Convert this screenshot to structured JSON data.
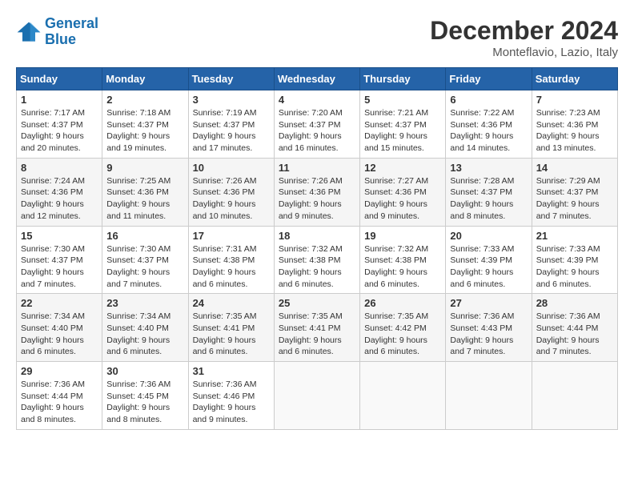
{
  "logo": {
    "line1": "General",
    "line2": "Blue"
  },
  "title": "December 2024",
  "location": "Monteflavio, Lazio, Italy",
  "header": {
    "days": [
      "Sunday",
      "Monday",
      "Tuesday",
      "Wednesday",
      "Thursday",
      "Friday",
      "Saturday"
    ]
  },
  "weeks": [
    [
      {
        "day": "1",
        "sunrise": "7:17 AM",
        "sunset": "4:37 PM",
        "daylight": "9 hours and 20 minutes."
      },
      {
        "day": "2",
        "sunrise": "7:18 AM",
        "sunset": "4:37 PM",
        "daylight": "9 hours and 19 minutes."
      },
      {
        "day": "3",
        "sunrise": "7:19 AM",
        "sunset": "4:37 PM",
        "daylight": "9 hours and 17 minutes."
      },
      {
        "day": "4",
        "sunrise": "7:20 AM",
        "sunset": "4:37 PM",
        "daylight": "9 hours and 16 minutes."
      },
      {
        "day": "5",
        "sunrise": "7:21 AM",
        "sunset": "4:37 PM",
        "daylight": "9 hours and 15 minutes."
      },
      {
        "day": "6",
        "sunrise": "7:22 AM",
        "sunset": "4:36 PM",
        "daylight": "9 hours and 14 minutes."
      },
      {
        "day": "7",
        "sunrise": "7:23 AM",
        "sunset": "4:36 PM",
        "daylight": "9 hours and 13 minutes."
      }
    ],
    [
      {
        "day": "8",
        "sunrise": "7:24 AM",
        "sunset": "4:36 PM",
        "daylight": "9 hours and 12 minutes."
      },
      {
        "day": "9",
        "sunrise": "7:25 AM",
        "sunset": "4:36 PM",
        "daylight": "9 hours and 11 minutes."
      },
      {
        "day": "10",
        "sunrise": "7:26 AM",
        "sunset": "4:36 PM",
        "daylight": "9 hours and 10 minutes."
      },
      {
        "day": "11",
        "sunrise": "7:26 AM",
        "sunset": "4:36 PM",
        "daylight": "9 hours and 9 minutes."
      },
      {
        "day": "12",
        "sunrise": "7:27 AM",
        "sunset": "4:36 PM",
        "daylight": "9 hours and 9 minutes."
      },
      {
        "day": "13",
        "sunrise": "7:28 AM",
        "sunset": "4:37 PM",
        "daylight": "9 hours and 8 minutes."
      },
      {
        "day": "14",
        "sunrise": "7:29 AM",
        "sunset": "4:37 PM",
        "daylight": "9 hours and 7 minutes."
      }
    ],
    [
      {
        "day": "15",
        "sunrise": "7:30 AM",
        "sunset": "4:37 PM",
        "daylight": "9 hours and 7 minutes."
      },
      {
        "day": "16",
        "sunrise": "7:30 AM",
        "sunset": "4:37 PM",
        "daylight": "9 hours and 7 minutes."
      },
      {
        "day": "17",
        "sunrise": "7:31 AM",
        "sunset": "4:38 PM",
        "daylight": "9 hours and 6 minutes."
      },
      {
        "day": "18",
        "sunrise": "7:32 AM",
        "sunset": "4:38 PM",
        "daylight": "9 hours and 6 minutes."
      },
      {
        "day": "19",
        "sunrise": "7:32 AM",
        "sunset": "4:38 PM",
        "daylight": "9 hours and 6 minutes."
      },
      {
        "day": "20",
        "sunrise": "7:33 AM",
        "sunset": "4:39 PM",
        "daylight": "9 hours and 6 minutes."
      },
      {
        "day": "21",
        "sunrise": "7:33 AM",
        "sunset": "4:39 PM",
        "daylight": "9 hours and 6 minutes."
      }
    ],
    [
      {
        "day": "22",
        "sunrise": "7:34 AM",
        "sunset": "4:40 PM",
        "daylight": "9 hours and 6 minutes."
      },
      {
        "day": "23",
        "sunrise": "7:34 AM",
        "sunset": "4:40 PM",
        "daylight": "9 hours and 6 minutes."
      },
      {
        "day": "24",
        "sunrise": "7:35 AM",
        "sunset": "4:41 PM",
        "daylight": "9 hours and 6 minutes."
      },
      {
        "day": "25",
        "sunrise": "7:35 AM",
        "sunset": "4:41 PM",
        "daylight": "9 hours and 6 minutes."
      },
      {
        "day": "26",
        "sunrise": "7:35 AM",
        "sunset": "4:42 PM",
        "daylight": "9 hours and 6 minutes."
      },
      {
        "day": "27",
        "sunrise": "7:36 AM",
        "sunset": "4:43 PM",
        "daylight": "9 hours and 7 minutes."
      },
      {
        "day": "28",
        "sunrise": "7:36 AM",
        "sunset": "4:44 PM",
        "daylight": "9 hours and 7 minutes."
      }
    ],
    [
      {
        "day": "29",
        "sunrise": "7:36 AM",
        "sunset": "4:44 PM",
        "daylight": "9 hours and 8 minutes."
      },
      {
        "day": "30",
        "sunrise": "7:36 AM",
        "sunset": "4:45 PM",
        "daylight": "9 hours and 8 minutes."
      },
      {
        "day": "31",
        "sunrise": "7:36 AM",
        "sunset": "4:46 PM",
        "daylight": "9 hours and 9 minutes."
      },
      null,
      null,
      null,
      null
    ]
  ]
}
